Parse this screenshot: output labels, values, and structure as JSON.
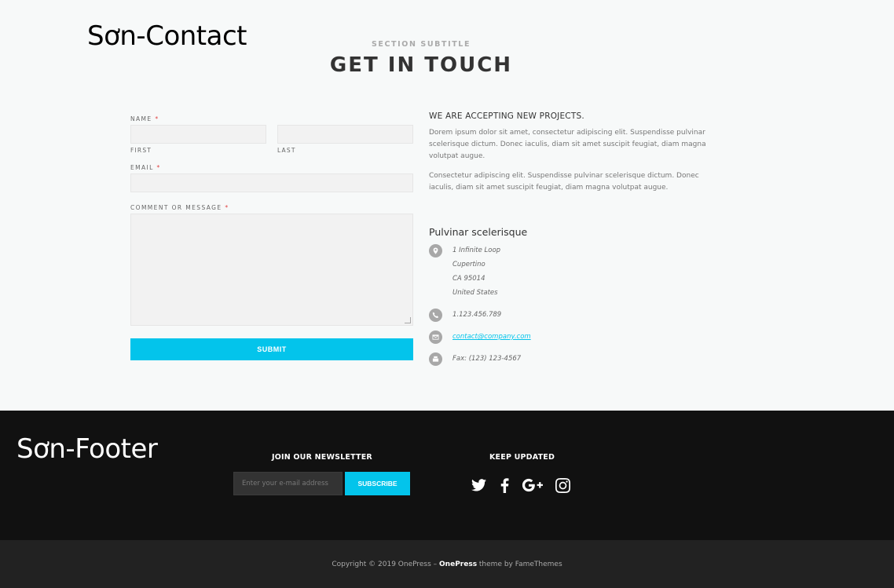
{
  "contact": {
    "overlay_label": "Sơn-Contact",
    "section_subtitle": "SECTION SUBTITLE",
    "section_title": "GET IN TOUCH",
    "form": {
      "name_label": "NAME",
      "first_sub": "FIRST",
      "last_sub": "LAST",
      "email_label": "EMAIL",
      "message_label": "COMMENT OR MESSAGE",
      "required_mark": "*",
      "submit_label": "SUBMIT"
    },
    "info": {
      "heading": "WE ARE ACCEPTING NEW PROJECTS.",
      "paragraph1": "Dorem ipsum dolor sit amet, consectetur adipiscing elit. Suspendisse pulvinar scelerisque dictum. Donec iaculis, diam sit amet suscipit feugiat, diam magna volutpat augue.",
      "paragraph2": "Consectetur adipiscing elit. Suspendisse pulvinar scelerisque dictum. Donec iaculis, diam sit amet suscipit feugiat, diam magna volutpat augue.",
      "subheading": "Pulvinar scelerisque",
      "address": [
        "1 Infinite Loop",
        "Cupertino",
        "CA 95014",
        "United States"
      ],
      "phone": "1.123.456.789",
      "email": "contact@company.com",
      "fax": "Fax: (123) 123-4567"
    }
  },
  "footer": {
    "overlay_label": "Sơn-Footer",
    "newsletter_heading": "JOIN OUR NEWSLETTER",
    "newsletter_placeholder": "Enter your e-mail address",
    "subscribe_label": "SUBSCRIBE",
    "social_heading": "KEEP UPDATED",
    "social_icons": [
      "twitter-icon",
      "facebook-icon",
      "google-plus-icon",
      "instagram-icon"
    ],
    "copyright_prefix": "Copyright © 2019 OnePress – ",
    "copyright_brand": "OnePress",
    "copyright_suffix": " theme by FameThemes"
  },
  "colors": {
    "accent": "#03c4eb",
    "footer_bg": "#111111",
    "copyright_bg": "#222222",
    "section_bg": "#f7f9f9"
  }
}
